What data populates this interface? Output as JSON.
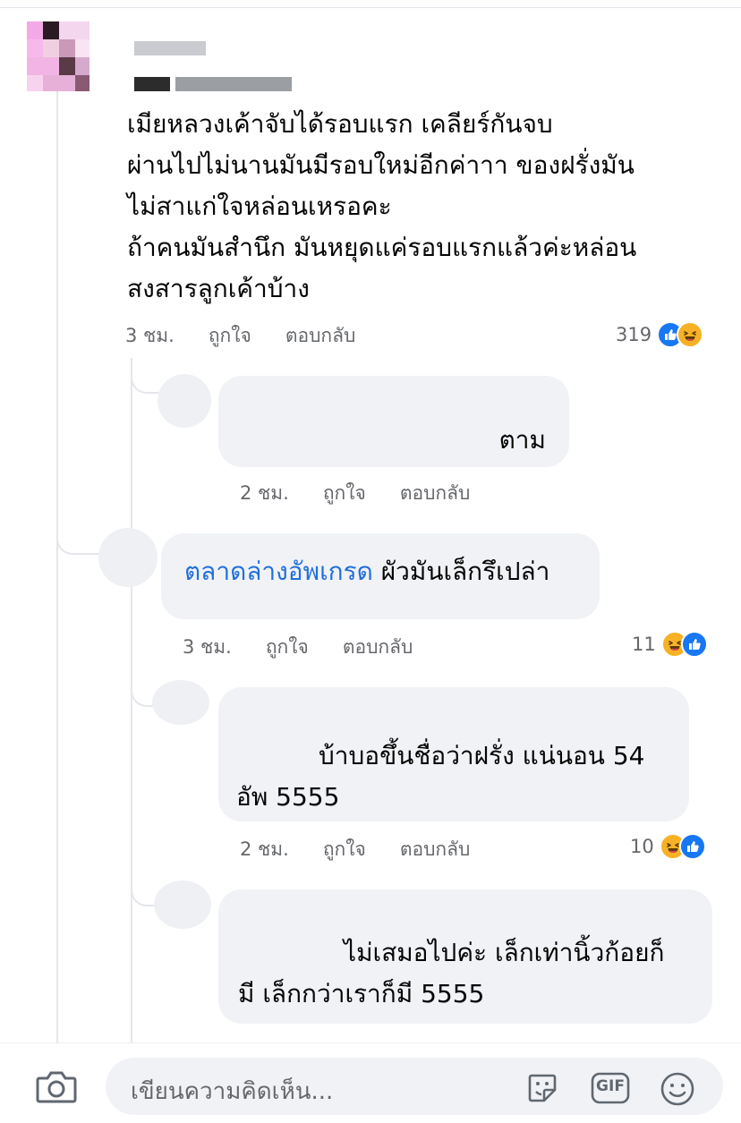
{
  "comments": [
    {
      "lines": [
        "เมียหลวงเค้าจับได้รอบแรก เคลียร์กันจบ",
        "ผ่านไปไม่นานมันมีรอบใหม่อีกค่าาา ของฝรั่งมัน",
        "ไม่สาแก่ใจหล่อนเหรอคะ",
        "ถ้าคนมันสำนึก มันหยุดแค่รอบแรกแล้วค่ะหล่อน",
        "สงสารลูกเค้าบ้าง"
      ],
      "time": "3 ชม.",
      "like_label": "ถูกใจ",
      "reply_label": "ตอบกลับ",
      "reaction_count": "319"
    },
    {
      "lines": [
        "ตาม"
      ],
      "time": "2 ชม.",
      "like_label": "ถูกใจ",
      "reply_label": "ตอบกลับ"
    },
    {
      "mention": "ตลาดล่างอัพเกรด",
      "text": " ผัวมันเล็กรึเปล่า",
      "time": "3 ชม.",
      "like_label": "ถูกใจ",
      "reply_label": "ตอบกลับ",
      "reaction_count": "11"
    },
    {
      "lines": [
        "บ้าบอขึ้นชื่อว่าฝรั่ง แน่นอน 54",
        "อัพ 5555"
      ],
      "time": "2 ชม.",
      "like_label": "ถูกใจ",
      "reply_label": "ตอบกลับ",
      "reaction_count": "10"
    },
    {
      "lines": [
        "ไม่เสมอไปค่ะ เล็กเท่านิ้วก้อยก็",
        "มี เล็กกว่าเราก็มี 5555"
      ]
    }
  ],
  "composer": {
    "placeholder": "เขียนความคิดเห็น...",
    "camera_icon": "camera-icon",
    "sticker_icon": "sticker-icon",
    "gif_label": "GIF",
    "emoji_icon": "emoji-icon"
  },
  "colors": {
    "like": "#1877f2",
    "haha": "#f7b125",
    "mention": "#216fdb",
    "bubble": "#f0f2f5",
    "meta_text": "#65676b"
  }
}
